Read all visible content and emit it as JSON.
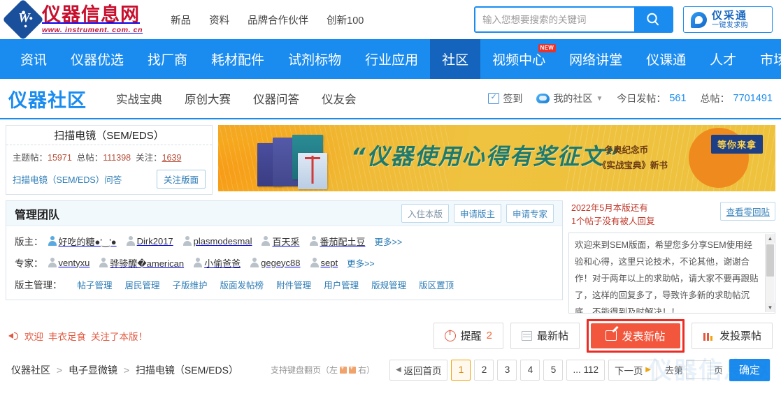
{
  "header": {
    "logo_cn": "仪器信息网",
    "logo_en": "www. instrument. com. cn",
    "top_links": [
      "新品",
      "资料",
      "品牌合作伙伴",
      "创新100"
    ],
    "search": {
      "placeholder": "输入您想要搜索的关键词",
      "value": "",
      "icon": "search-icon"
    },
    "caigou": {
      "title": "仪采通",
      "subtitle": "一键发求购"
    }
  },
  "main_nav": {
    "items": [
      {
        "label": "资讯",
        "active": false,
        "badge": ""
      },
      {
        "label": "仪器优选",
        "active": false,
        "badge": ""
      },
      {
        "label": "找厂商",
        "active": false,
        "badge": ""
      },
      {
        "label": "耗材配件",
        "active": false,
        "badge": ""
      },
      {
        "label": "试剂标物",
        "active": false,
        "badge": ""
      },
      {
        "label": "行业应用",
        "active": false,
        "badge": ""
      },
      {
        "label": "社区",
        "active": true,
        "badge": ""
      },
      {
        "label": "视频中心",
        "active": false,
        "badge": "NEW"
      },
      {
        "label": "网络讲堂",
        "active": false,
        "badge": ""
      },
      {
        "label": "仪课通",
        "active": false,
        "badge": ""
      },
      {
        "label": "人才",
        "active": false,
        "badge": ""
      },
      {
        "label": "市场调研",
        "active": false,
        "badge": ""
      }
    ],
    "active_color": "#1464bd",
    "bar_color": "#1a8cf0"
  },
  "sub_nav": {
    "brand": "仪器社区",
    "items": [
      "实战宝典",
      "原创大赛",
      "仪器问答",
      "仪友会"
    ],
    "sign_in": "签到",
    "my_community": "我的社区",
    "today_posts_label": "今日发帖：",
    "today_posts_value": "561",
    "total_posts_label": "总帖：",
    "total_posts_value": "7701491"
  },
  "forum_card": {
    "title": "扫描电镜（SEM/EDS）",
    "topic_label": "主题帖：",
    "topic_value": "15971",
    "total_label": "总帖：",
    "total_value": "111398",
    "follow_label": "关注：",
    "follow_value": "1639",
    "qa_link": "扫描电镜（SEM/EDS）问答",
    "follow_button": "关注版面"
  },
  "banner": {
    "headline": "“仪器使用心得有奖征文”",
    "bullets": [
      "· 冬奥纪念币",
      "·《实战宝典》新书"
    ],
    "tag": "等你来拿"
  },
  "manage": {
    "title": "管理团队",
    "buttons": [
      "入住本版",
      "申请版主",
      "申请专家"
    ],
    "moderator_label": "版主：",
    "moderators": [
      "好吃的糖●'‿'●",
      "Dirk2017",
      "plasmodesmal",
      "百天采",
      "番茄配土豆"
    ],
    "moderator_more": "更多>>",
    "expert_label": "专家：",
    "experts": [
      "ventyxu",
      "骅骖醾�american",
      "小偷爸爸",
      "gegeyc88",
      "sept"
    ],
    "expert_more": "更多>>",
    "admin_label": "版主管理：",
    "admin_links": [
      "帖子管理",
      "居民管理",
      "子版维护",
      "版面发帖榜",
      "附件管理",
      "用户管理",
      "版规管理",
      "版区置顶"
    ]
  },
  "announce": {
    "red_line1": "2022年5月本版还有",
    "red_line2": "1个帖子没有被人回复",
    "zero_reply_button": "查看零回贴",
    "body": "欢迎来到SEM版面，希望您多分享SEM使用经验和心得，这里只论技术，不论其他，谢谢合作！对于两年以上的求助帖，请大家不要再跟贴了，这样的回复多了，导致许多新的求助帖沉底，不能得到及时解决！！"
  },
  "action_bar": {
    "welcome_prefix": "欢迎",
    "welcome_user": "丰衣足食",
    "welcome_suffix": "关注了本版！",
    "buttons": [
      {
        "label": "提醒",
        "sup": "2",
        "icon": "bell-icon",
        "primary": false
      },
      {
        "label": "最新帖",
        "sup": "",
        "icon": "list-icon",
        "primary": false
      },
      {
        "label": "发表新帖",
        "sup": "",
        "icon": "pencil-icon",
        "primary": true
      },
      {
        "label": "发投票帖",
        "sup": "",
        "icon": "chart-icon",
        "primary": false
      }
    ],
    "highlight_color": "#ee2b23",
    "primary_color": "#f2573d"
  },
  "footer": {
    "breadcrumb": [
      "仪器社区",
      "电子显微镜",
      "扫描电镜（SEM/EDS）"
    ],
    "kbd_hint_pre": "支持键盘翻页（左",
    "kbd_hint_post": "右）",
    "pager": {
      "first": "返回首页",
      "pages": [
        "1",
        "2",
        "3",
        "4",
        "5"
      ],
      "current": "1",
      "ellipsis": "... 112",
      "next": "下一页",
      "goto_label": "去第",
      "goto_value": "",
      "page_unit": "页",
      "ok": "确定"
    }
  },
  "watermark": "仪器信息网"
}
